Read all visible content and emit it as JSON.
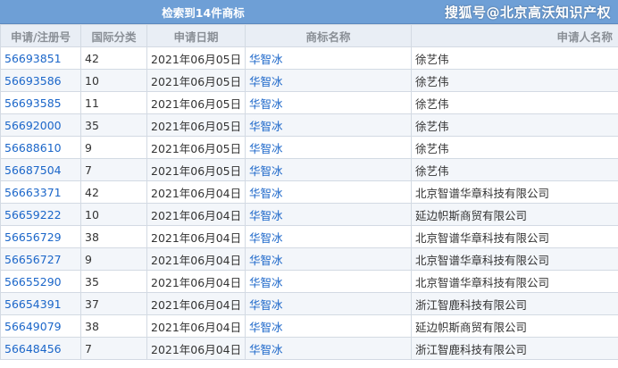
{
  "header": {
    "title": "检索到14件商标",
    "watermark": "搜狐号@北京高沃知识产权"
  },
  "columns": [
    "申请/注册号",
    "国际分类",
    "申请日期",
    "商标名称",
    "申请人名称"
  ],
  "rows": [
    {
      "reg_no": "56693851",
      "class": "42",
      "date": "2021年06月05日",
      "name": "华智冰",
      "applicant": "徐艺伟"
    },
    {
      "reg_no": "56693586",
      "class": "10",
      "date": "2021年06月05日",
      "name": "华智冰",
      "applicant": "徐艺伟"
    },
    {
      "reg_no": "56693585",
      "class": "11",
      "date": "2021年06月05日",
      "name": "华智冰",
      "applicant": "徐艺伟"
    },
    {
      "reg_no": "56692000",
      "class": "35",
      "date": "2021年06月05日",
      "name": "华智冰",
      "applicant": "徐艺伟"
    },
    {
      "reg_no": "56688610",
      "class": "9",
      "date": "2021年06月05日",
      "name": "华智冰",
      "applicant": "徐艺伟"
    },
    {
      "reg_no": "56687504",
      "class": "7",
      "date": "2021年06月05日",
      "name": "华智冰",
      "applicant": "徐艺伟"
    },
    {
      "reg_no": "56663371",
      "class": "42",
      "date": "2021年06月04日",
      "name": "华智冰",
      "applicant": "北京智谱华章科技有限公司"
    },
    {
      "reg_no": "56659222",
      "class": "10",
      "date": "2021年06月04日",
      "name": "华智冰",
      "applicant": "延边帜斯商贸有限公司"
    },
    {
      "reg_no": "56656729",
      "class": "38",
      "date": "2021年06月04日",
      "name": "华智冰",
      "applicant": "北京智谱华章科技有限公司"
    },
    {
      "reg_no": "56656727",
      "class": "9",
      "date": "2021年06月04日",
      "name": "华智冰",
      "applicant": "北京智谱华章科技有限公司"
    },
    {
      "reg_no": "56655290",
      "class": "35",
      "date": "2021年06月04日",
      "name": "华智冰",
      "applicant": "北京智谱华章科技有限公司"
    },
    {
      "reg_no": "56654391",
      "class": "37",
      "date": "2021年06月04日",
      "name": "华智冰",
      "applicant": "浙江智鹿科技有限公司"
    },
    {
      "reg_no": "56649079",
      "class": "38",
      "date": "2021年06月04日",
      "name": "华智冰",
      "applicant": "延边帜斯商贸有限公司"
    },
    {
      "reg_no": "56648456",
      "class": "7",
      "date": "2021年06月04日",
      "name": "华智冰",
      "applicant": "浙江智鹿科技有限公司"
    }
  ]
}
